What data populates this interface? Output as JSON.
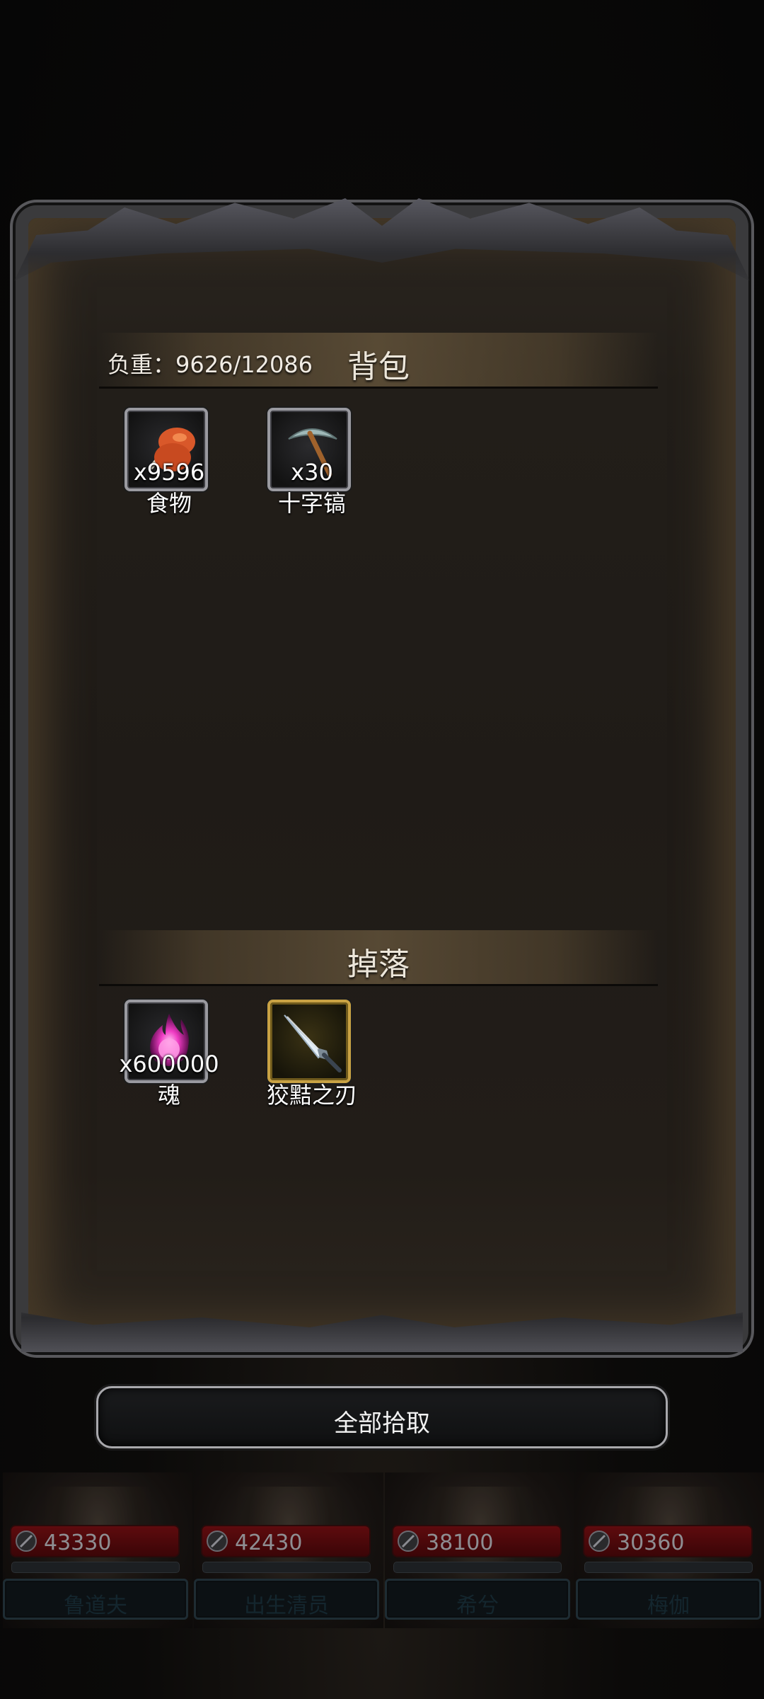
{
  "backpack": {
    "title": "背包",
    "load_label": "负重：9626/12086",
    "items": [
      {
        "qty": "x9596",
        "name": "食物",
        "icon": "meat-icon"
      },
      {
        "qty": "x30",
        "name": "十字镐",
        "icon": "pickaxe-icon"
      }
    ]
  },
  "drops": {
    "title": "掉落",
    "items": [
      {
        "qty": "x600000",
        "name": "魂",
        "icon": "soul-orb-icon"
      },
      {
        "qty": "",
        "name": "狡黠之刃",
        "icon": "blade-icon"
      }
    ]
  },
  "actions": {
    "pick_all_label": "全部拾取"
  },
  "heroes": [
    {
      "hp": "43330",
      "name": "鲁道夫"
    },
    {
      "hp": "42430",
      "name": "出生清员"
    },
    {
      "hp": "38100",
      "name": "希兮"
    },
    {
      "hp": "30360",
      "name": "梅伽"
    }
  ],
  "colors": {
    "frame": "#3a3a3c",
    "panel": "#1f1b17",
    "hp_bar": "#5e0b0e",
    "gold_border": "#c9a244"
  }
}
